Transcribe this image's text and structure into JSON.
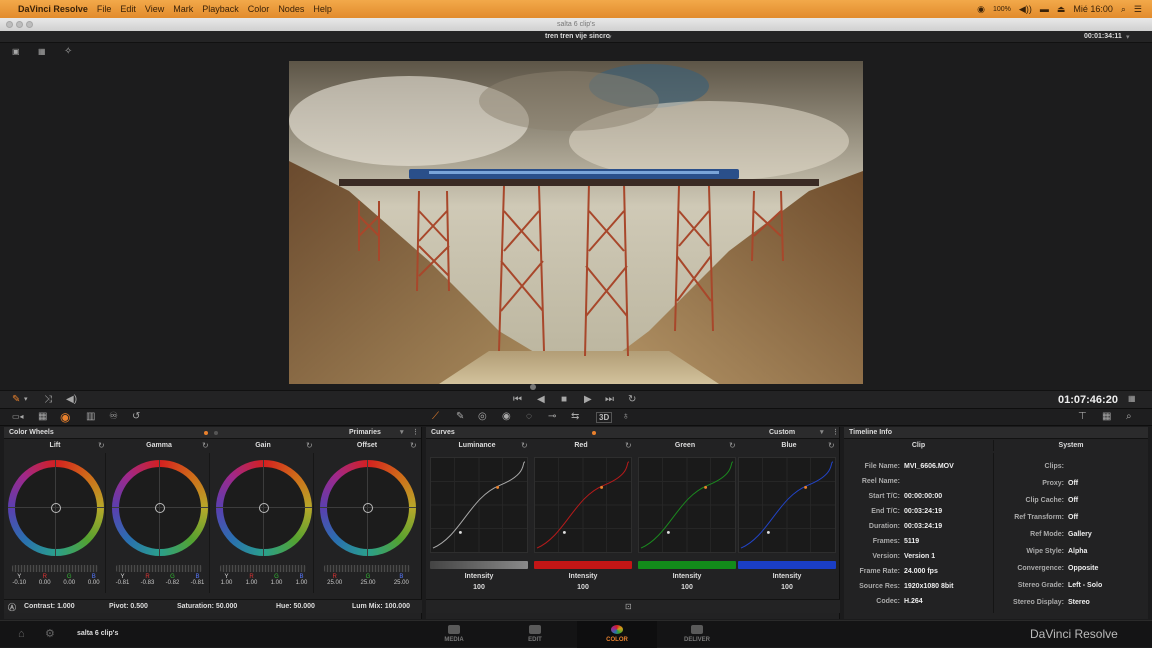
{
  "menubar": {
    "apple": "",
    "app": "DaVinci Resolve",
    "items": [
      "File",
      "Edit",
      "View",
      "Mark",
      "Playback",
      "Color",
      "Nodes",
      "Help"
    ],
    "battery": "100%",
    "clock": "Mié 16:00"
  },
  "window": {
    "title": "salta 6 clip's"
  },
  "viewer": {
    "timeline_name": "tren tren vije sincro",
    "timecode_top": "00:01:34:11"
  },
  "transport": {
    "timecode": "01:07:46:20",
    "three_d": "3D"
  },
  "color_wheels": {
    "title": "Color Wheels",
    "mode": "Primaries",
    "wheels": [
      {
        "name": "Lift",
        "labels": [
          "Y",
          "R",
          "G",
          "B"
        ],
        "values": [
          "-0.10",
          "0.00",
          "0.00",
          "0.00"
        ]
      },
      {
        "name": "Gamma",
        "labels": [
          "Y",
          "R",
          "G",
          "B"
        ],
        "values": [
          "-0.81",
          "-0.83",
          "-0.82",
          "-0.81"
        ]
      },
      {
        "name": "Gain",
        "labels": [
          "Y",
          "R",
          "G",
          "B"
        ],
        "values": [
          "1.00",
          "1.00",
          "1.00",
          "1.00"
        ]
      },
      {
        "name": "Offset",
        "labels": [
          "R",
          "G",
          "B"
        ],
        "values": [
          "25.00",
          "25.00",
          "25.00"
        ]
      }
    ],
    "footer": {
      "contrast_label": "Contrast:",
      "contrast": "1.000",
      "pivot_label": "Pivot:",
      "pivot": "0.500",
      "saturation_label": "Saturation:",
      "saturation": "50.000",
      "hue_label": "Hue:",
      "hue": "50.000",
      "lummix_label": "Lum Mix:",
      "lummix": "100.000"
    }
  },
  "curves": {
    "title": "Curves",
    "mode": "Custom",
    "channels": [
      {
        "name": "Luminance",
        "label": "Intensity",
        "value": "100",
        "color": "#8a8a8a"
      },
      {
        "name": "Red",
        "label": "Intensity",
        "value": "100",
        "color": "#c41616"
      },
      {
        "name": "Green",
        "label": "Intensity",
        "value": "100",
        "color": "#128c1a"
      },
      {
        "name": "Blue",
        "label": "Intensity",
        "value": "100",
        "color": "#1a3ec4"
      }
    ]
  },
  "timeline_info": {
    "title": "Timeline Info",
    "clip_header": "Clip",
    "system_header": "System",
    "clip": [
      {
        "k": "File Name:",
        "v": "MVI_6606.MOV"
      },
      {
        "k": "Reel Name:",
        "v": ""
      },
      {
        "k": "Start T/C:",
        "v": "00:00:00:00"
      },
      {
        "k": "End T/C:",
        "v": "00:03:24:19"
      },
      {
        "k": "Duration:",
        "v": "00:03:24:19"
      },
      {
        "k": "Frames:",
        "v": "5119"
      },
      {
        "k": "Version:",
        "v": "Version 1"
      },
      {
        "k": "Frame Rate:",
        "v": "24.000 fps"
      },
      {
        "k": "Source Res:",
        "v": "1920x1080 8bit"
      },
      {
        "k": "Codec:",
        "v": "H.264"
      }
    ],
    "system": [
      {
        "k": "Clips:",
        "v": ""
      },
      {
        "k": "Proxy:",
        "v": "Off"
      },
      {
        "k": "Clip Cache:",
        "v": "Off"
      },
      {
        "k": "Ref Transform:",
        "v": "Off"
      },
      {
        "k": "Ref Mode:",
        "v": "Gallery"
      },
      {
        "k": "Wipe Style:",
        "v": "Alpha"
      },
      {
        "k": "Convergence:",
        "v": "Opposite"
      },
      {
        "k": "Stereo Grade:",
        "v": "Left - Solo"
      },
      {
        "k": "Stereo Display:",
        "v": "Stereo"
      }
    ]
  },
  "bottom": {
    "project": "salta 6 clip's",
    "pages": [
      "MEDIA",
      "EDIT",
      "COLOR",
      "DELIVER"
    ],
    "active_page": "COLOR",
    "brand": "DaVinci Resolve"
  },
  "colors": {
    "accent": "#e9812d",
    "menubar": "#e99a3a"
  }
}
